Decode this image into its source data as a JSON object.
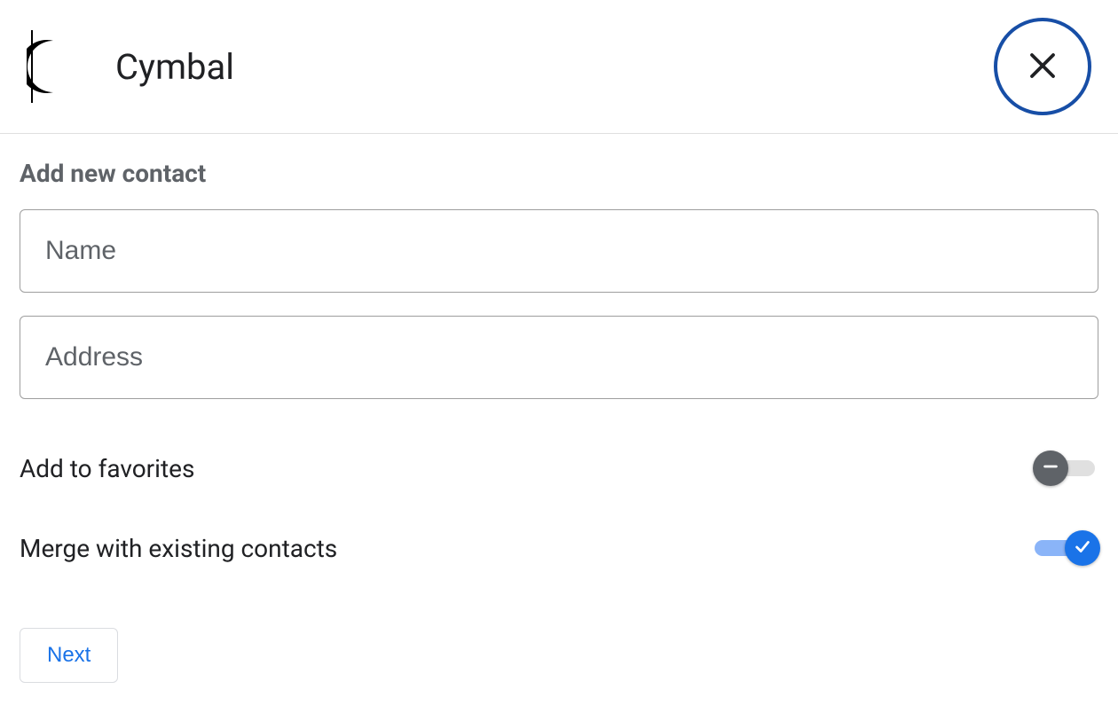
{
  "header": {
    "brand_name": "Cymbal"
  },
  "form": {
    "title": "Add new contact",
    "fields": {
      "name": {
        "placeholder": "Name",
        "value": ""
      },
      "address": {
        "placeholder": "Address",
        "value": ""
      }
    },
    "toggles": {
      "favorites": {
        "label": "Add to favorites",
        "on": false
      },
      "merge": {
        "label": "Merge with existing contacts",
        "on": true
      }
    },
    "next_label": "Next"
  },
  "colors": {
    "primary": "#1a73e8",
    "primary_dark": "#174ea6",
    "toggle_on_track": "#8ab4f8",
    "toggle_off_thumb": "#5f6368",
    "border": "#dadce0",
    "text_muted": "#5f6368",
    "text": "#202124"
  }
}
